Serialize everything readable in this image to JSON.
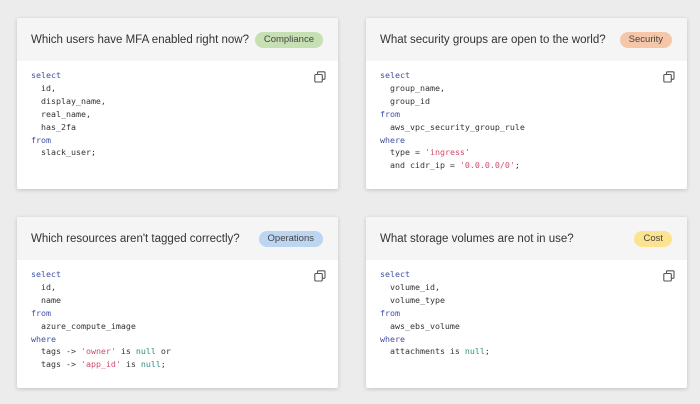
{
  "cards": [
    {
      "question": "Which users have MFA enabled right now?",
      "badge": "Compliance",
      "badge_color": "#c6e0b4",
      "lines": [
        [
          {
            "t": "select",
            "c": "kw"
          }
        ],
        [
          {
            "t": "  id,",
            "c": ""
          }
        ],
        [
          {
            "t": "  display_name,",
            "c": ""
          }
        ],
        [
          {
            "t": "  real_name,",
            "c": ""
          }
        ],
        [
          {
            "t": "  has_2fa",
            "c": ""
          }
        ],
        [
          {
            "t": "from",
            "c": "kw"
          }
        ],
        [
          {
            "t": "  slack_user;",
            "c": ""
          }
        ]
      ]
    },
    {
      "question": "What security groups are open to the world?",
      "badge": "Security",
      "badge_color": "#f5c6a8",
      "lines": [
        [
          {
            "t": "select",
            "c": "kw"
          }
        ],
        [
          {
            "t": "  group_name,",
            "c": ""
          }
        ],
        [
          {
            "t": "  group_id",
            "c": ""
          }
        ],
        [
          {
            "t": "from",
            "c": "kw"
          }
        ],
        [
          {
            "t": "  aws_vpc_security_group_rule",
            "c": ""
          }
        ],
        [
          {
            "t": "where",
            "c": "kw"
          }
        ],
        [
          {
            "t": "  type = ",
            "c": ""
          },
          {
            "t": "'ingress'",
            "c": "str"
          }
        ],
        [
          {
            "t": "  and cidr_ip = ",
            "c": ""
          },
          {
            "t": "'0.0.0.0/0'",
            "c": "str"
          },
          {
            "t": ";",
            "c": ""
          }
        ]
      ]
    },
    {
      "question": "Which resources aren't tagged correctly?",
      "badge": "Operations",
      "badge_color": "#bcd5f0",
      "lines": [
        [
          {
            "t": "select",
            "c": "kw"
          }
        ],
        [
          {
            "t": "  id,",
            "c": ""
          }
        ],
        [
          {
            "t": "  name",
            "c": ""
          }
        ],
        [
          {
            "t": "from",
            "c": "kw"
          }
        ],
        [
          {
            "t": "  azure_compute_image",
            "c": ""
          }
        ],
        [
          {
            "t": "where",
            "c": "kw"
          }
        ],
        [
          {
            "t": "  tags -> ",
            "c": ""
          },
          {
            "t": "'owner'",
            "c": "str"
          },
          {
            "t": " is ",
            "c": ""
          },
          {
            "t": "null",
            "c": "lit"
          },
          {
            "t": " or",
            "c": ""
          }
        ],
        [
          {
            "t": "  tags -> ",
            "c": ""
          },
          {
            "t": "'app_id'",
            "c": "str"
          },
          {
            "t": " is ",
            "c": ""
          },
          {
            "t": "null",
            "c": "lit"
          },
          {
            "t": ";",
            "c": ""
          }
        ]
      ]
    },
    {
      "question": "What storage volumes are not in use?",
      "badge": "Cost",
      "badge_color": "#fbe38f",
      "lines": [
        [
          {
            "t": "select",
            "c": "kw"
          }
        ],
        [
          {
            "t": "  volume_id,",
            "c": ""
          }
        ],
        [
          {
            "t": "  volume_type",
            "c": ""
          }
        ],
        [
          {
            "t": "from",
            "c": "kw"
          }
        ],
        [
          {
            "t": "  aws_ebs_volume",
            "c": ""
          }
        ],
        [
          {
            "t": "where",
            "c": "kw"
          }
        ],
        [
          {
            "t": "  attachments is ",
            "c": ""
          },
          {
            "t": "null",
            "c": "lit"
          },
          {
            "t": ";",
            "c": ""
          }
        ]
      ]
    }
  ],
  "icons": {
    "copy": "copy-icon"
  },
  "colors": {
    "keyword": "#3f4ea3",
    "string": "#d14a6c",
    "literal": "#2f8f80"
  }
}
